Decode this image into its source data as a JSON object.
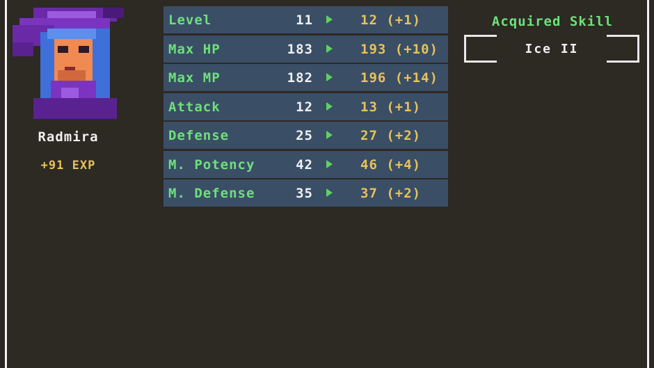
{
  "character": {
    "name": "Radmira",
    "exp_gain": "+91 EXP",
    "portrait": "witch-portrait"
  },
  "stats": [
    {
      "label": "Level",
      "old": "11",
      "new": "12 (+1)"
    },
    {
      "label": "Max HP",
      "old": "183",
      "new": "193 (+10)"
    },
    {
      "label": "Max MP",
      "old": "182",
      "new": "196 (+14)"
    },
    {
      "label": "Attack",
      "old": "12",
      "new": "13 (+1)"
    },
    {
      "label": "Defense",
      "old": "25",
      "new": "27 (+2)"
    },
    {
      "label": "M. Potency",
      "old": "42",
      "new": "46 (+4)"
    },
    {
      "label": "M. Defense",
      "old": "35",
      "new": "37 (+2)"
    }
  ],
  "skill": {
    "title": "Acquired Skill",
    "name": "Ice II"
  },
  "colors": {
    "background": "#2d2923",
    "row": "#3a4e66",
    "label_green": "#6ee07a",
    "value_gold": "#e6c35a",
    "arrow_green": "#5fd25f"
  }
}
